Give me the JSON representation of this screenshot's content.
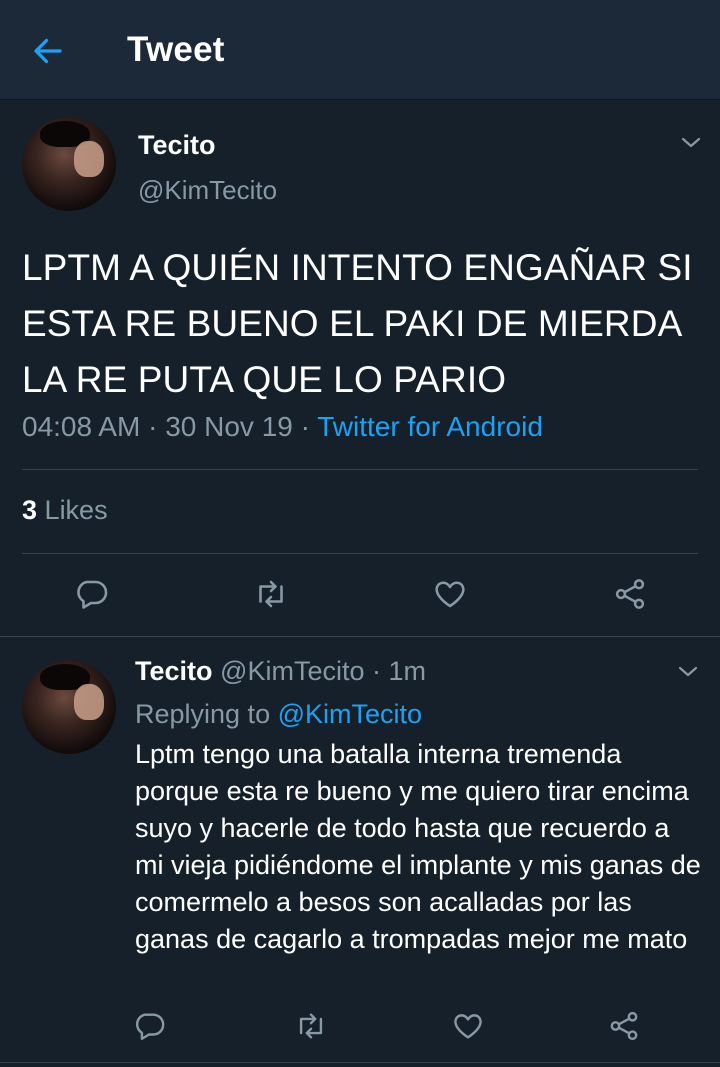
{
  "header": {
    "title": "Tweet",
    "back_icon": "arrow-left-icon",
    "accent": "#1da1f2"
  },
  "tweet": {
    "name": "Tecito",
    "handle": "@KimTecito",
    "text": "LPTM A QUIÉN INTENTO ENGAÑAR SI ESTA RE BUENO EL PAKI DE MIERDA LA RE PUTA QUE LO PARIO",
    "time": "04:08 AM",
    "date": "30 Nov 19",
    "source": "Twitter for Android",
    "likes_count": "3",
    "likes_label": "Likes"
  },
  "reply": {
    "name": "Tecito",
    "handle": "@KimTecito",
    "time": "1m",
    "replying_label": "Replying to",
    "replying_to": "@KimTecito",
    "text": "Lptm tengo una batalla interna tremenda porque esta re bueno y me quiero tirar encima suyo y hacerle de todo hasta que recuerdo a mi vieja pidiéndome el implante y mis ganas de comermelo a besos son acalladas por las ganas de cagarlo a trompadas mejor me mato"
  },
  "icons": {
    "reply": "reply-icon",
    "retweet": "retweet-icon",
    "like": "heart-icon",
    "share": "share-icon",
    "menu": "chevron-down-icon"
  },
  "colors": {
    "background": "#15202b",
    "header": "#1c2938",
    "muted": "#8899a6",
    "divider": "#38444d"
  }
}
